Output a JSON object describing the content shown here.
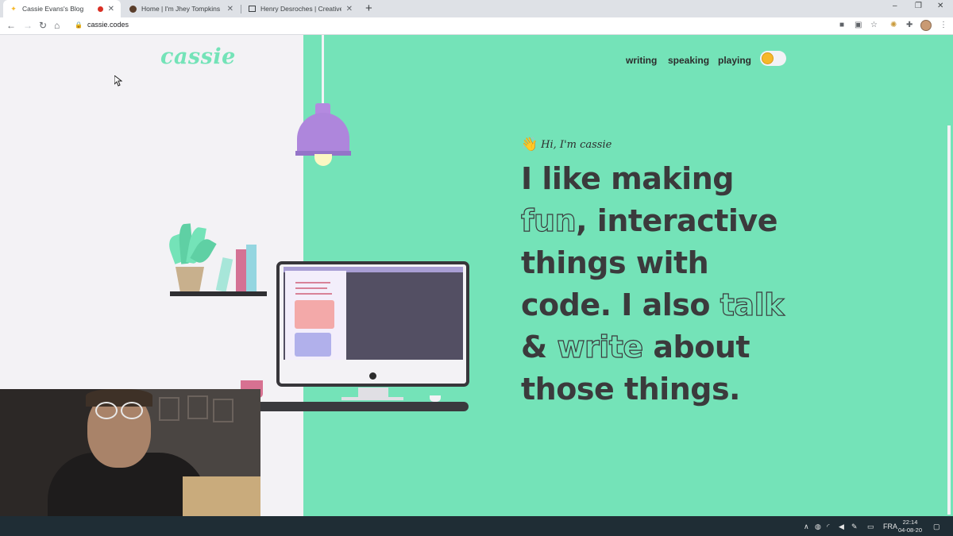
{
  "browser": {
    "tabs": [
      {
        "title": "Cassie Evans's Blog",
        "active": true,
        "recording": true
      },
      {
        "title": "Home | I'm Jhey Tompkins",
        "active": false
      },
      {
        "title": "Henry Desroches | Creative Deve",
        "active": false
      }
    ],
    "new_tab_symbol": "+",
    "url": "cassie.codes",
    "window_controls": {
      "minimize": "–",
      "restore": "❐",
      "close": "✕"
    },
    "toolbar_icons": [
      "video-camera-icon",
      "translate-icon",
      "star-icon",
      "extension-icon",
      "puzzle-icon"
    ]
  },
  "site": {
    "logo": "cassie",
    "nav": [
      {
        "label": "writing"
      },
      {
        "label": "speaking"
      },
      {
        "label": "playing"
      }
    ],
    "greeting_emoji": "👋",
    "greeting": "Hi, I'm cassie",
    "headline": {
      "l1": "I like making",
      "w_fun": "fun",
      "l2_rest": ", interactive",
      "l3": "things with",
      "l4_start": "code. I also ",
      "w_talk": "talk",
      "l5_start": "& ",
      "w_write": "write",
      "l5_end": " about",
      "l6": "those things."
    }
  },
  "taskbar": {
    "language": "FRA",
    "time": "22:14",
    "date": "04-08-20"
  },
  "colors": {
    "accent_green": "#74e3b8",
    "text_dark": "#3b3a3c",
    "page_bg": "#f3f2f5",
    "lamp_purple": "#ae86dc",
    "toggle_knob": "#f6b829"
  }
}
